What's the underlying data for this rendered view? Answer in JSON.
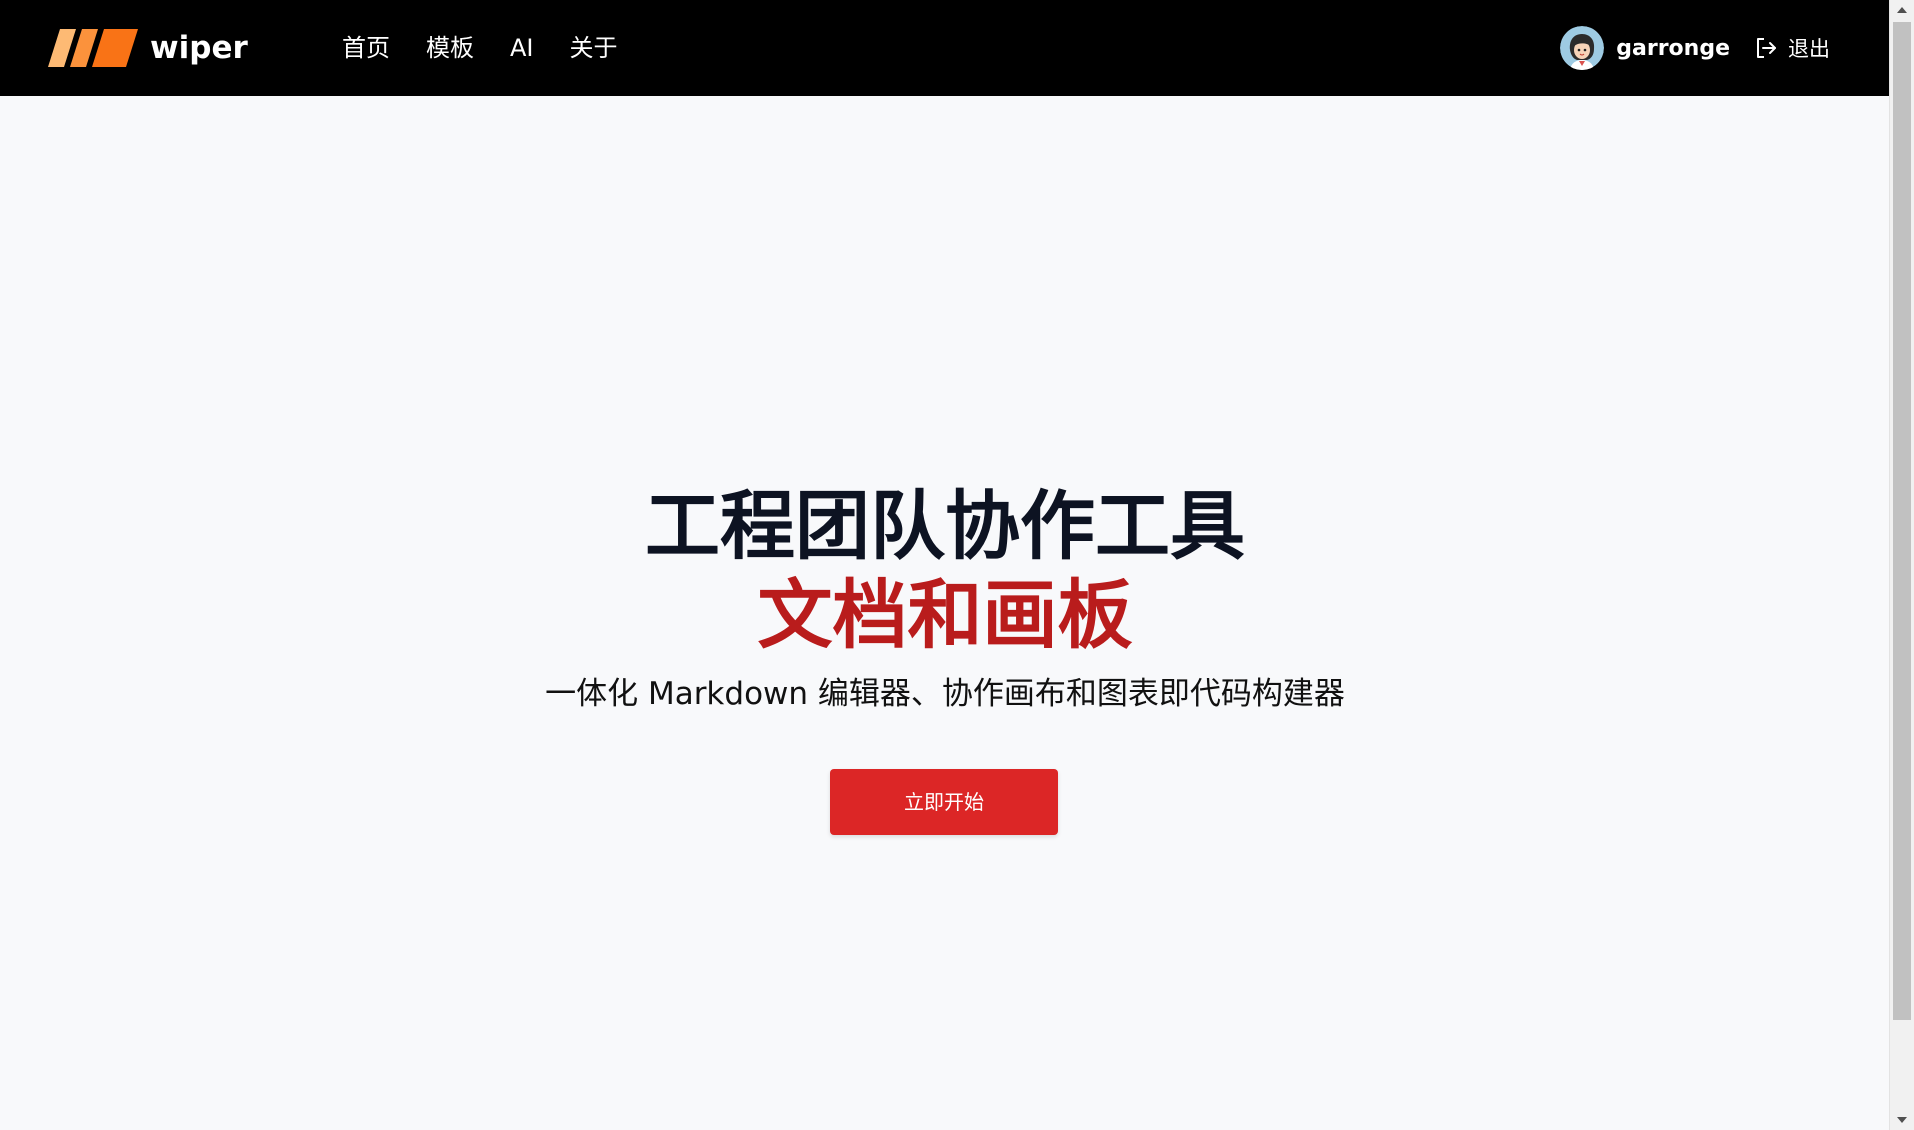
{
  "navbar": {
    "brand": "wiper",
    "links": [
      "首页",
      "模板",
      "AI",
      "关于"
    ],
    "user": {
      "name": "garronge",
      "logout_label": "退出"
    }
  },
  "hero": {
    "title": "工程团队协作工具",
    "highlight": "文档和画板",
    "subtitle": "一体化 Markdown 编辑器、协作画布和图表即代码构建器",
    "cta_label": "立即开始"
  },
  "colors": {
    "navbar_bg": "#000000",
    "page_bg": "#f8f9fb",
    "title": "#0d1322",
    "highlight": "#b91c1c",
    "cta": "#dc2626",
    "logo_orange_light": "#fdba74",
    "logo_orange": "#f97316"
  },
  "icons": {
    "logo": "brand-stripes-icon",
    "logout": "sign-out-icon",
    "avatar": "user-avatar"
  }
}
